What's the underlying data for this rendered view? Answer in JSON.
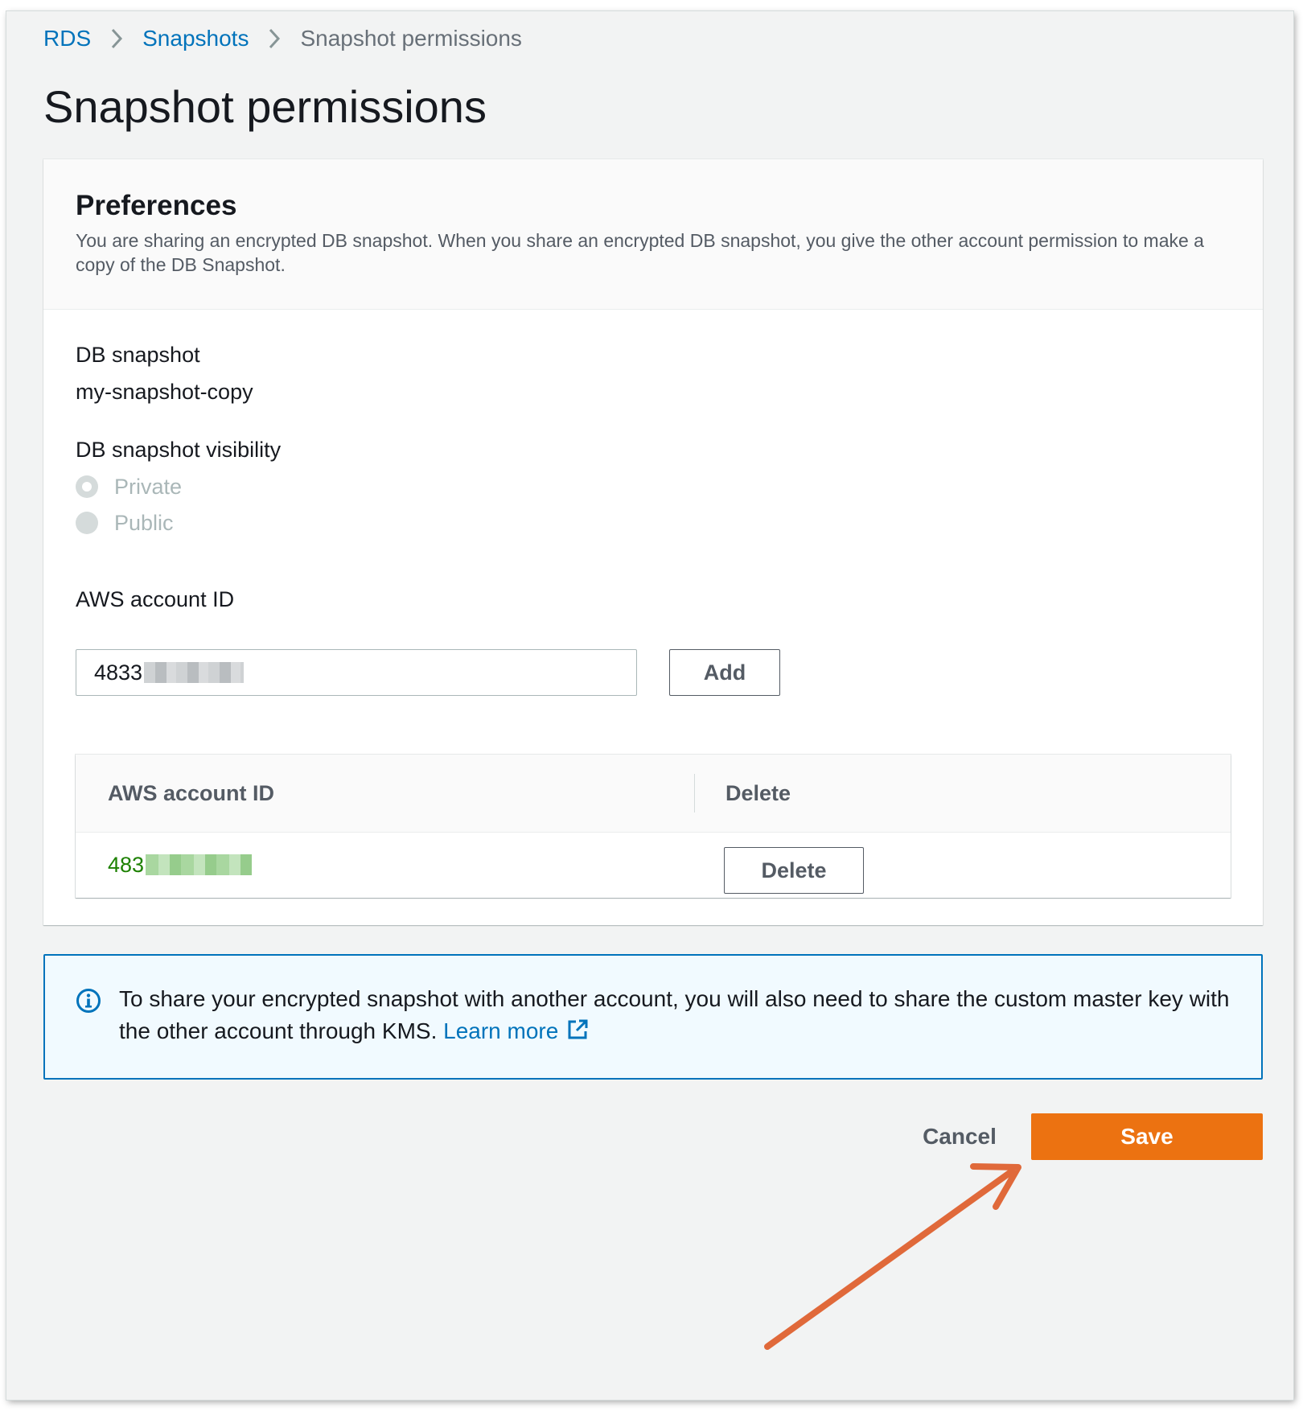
{
  "breadcrumb": {
    "items": [
      {
        "label": "RDS"
      },
      {
        "label": "Snapshots"
      }
    ],
    "current": "Snapshot permissions"
  },
  "page": {
    "title": "Snapshot permissions"
  },
  "preferences": {
    "title": "Preferences",
    "description": "You are sharing an encrypted DB snapshot. When you share an encrypted DB snapshot, you give the other account permission to make a copy of the DB Snapshot.",
    "db_snapshot_label": "DB snapshot",
    "db_snapshot_value": "my-snapshot-copy",
    "visibility_label": "DB snapshot visibility",
    "visibility_options": [
      {
        "label": "Private",
        "selected": true,
        "disabled": true
      },
      {
        "label": "Public",
        "selected": false,
        "disabled": true
      }
    ],
    "account_id_label": "AWS account ID",
    "account_id_input_value": "4833",
    "add_button": "Add"
  },
  "accounts_table": {
    "columns": [
      "AWS account ID",
      "Delete"
    ],
    "rows": [
      {
        "account_id": "483",
        "delete_label": "Delete"
      }
    ]
  },
  "alert": {
    "text": "To share your encrypted snapshot with another account, you will also need to share the custom master key with the other account through KMS.",
    "link": "Learn more"
  },
  "actions": {
    "cancel": "Cancel",
    "save": "Save"
  },
  "colors": {
    "link": "#0073bb",
    "primary": "#ec7211",
    "success_text": "#1d8102",
    "annotation_arrow": "#e0693a"
  }
}
